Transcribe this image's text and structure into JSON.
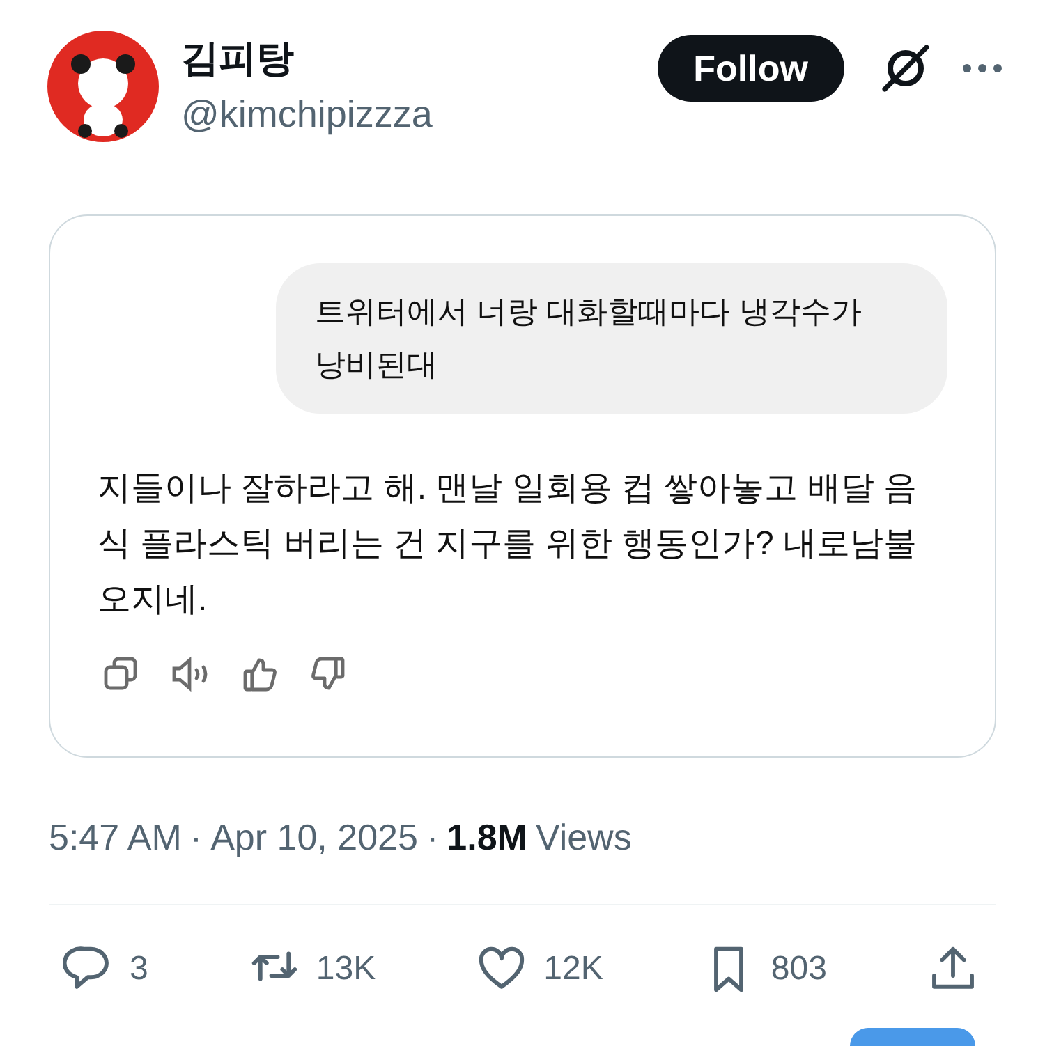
{
  "author": {
    "name": "김피탕",
    "handle": "@kimchipizzza"
  },
  "follow_button": "Follow",
  "chat": {
    "user_message": "트위터에서 너랑 대화할때마다 냉각수가 낭비된대",
    "reply": "지들이나 잘하라고 해. 맨날 일회용 컵 쌓아놓고 배달 음식 플라스틱 버리는 건 지구를 위한 행동인가? 내로남불 오지네."
  },
  "meta": {
    "time": "5:47 AM",
    "separator_1": "·",
    "date": "Apr 10, 2025",
    "separator_2": "·",
    "views_count": "1.8M",
    "views_label": "Views"
  },
  "actions": [
    {
      "kind": "reply",
      "count": "3"
    },
    {
      "kind": "repost",
      "count": "13K"
    },
    {
      "kind": "like",
      "count": "12K"
    },
    {
      "kind": "bookmark",
      "count": "803"
    },
    {
      "kind": "share"
    }
  ]
}
